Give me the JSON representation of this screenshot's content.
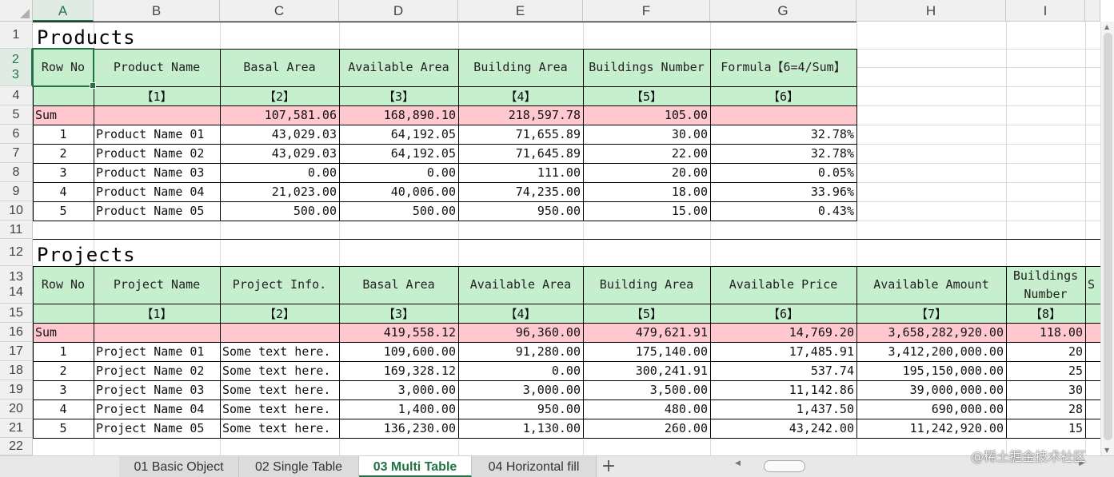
{
  "columns": [
    "A",
    "B",
    "C",
    "D",
    "E",
    "F",
    "G",
    "H",
    "I"
  ],
  "rows": [
    "1",
    "2",
    "3",
    "4",
    "5",
    "6",
    "7",
    "8",
    "9",
    "10",
    "11",
    "12",
    "13",
    "14",
    "15",
    "16",
    "17",
    "18",
    "19",
    "20",
    "21",
    "22"
  ],
  "products": {
    "title": "Products",
    "headers": [
      "Row No",
      "Product Name",
      "Basal Area",
      "Available Area",
      "Building Area",
      "Buildings Number",
      "Formula【6=4/Sum】"
    ],
    "codes": [
      "",
      "【1】",
      "【2】",
      "【3】",
      "【4】",
      "【5】",
      "【6】"
    ],
    "sum": [
      "Sum",
      "",
      "107,581.06",
      "168,890.10",
      "218,597.78",
      "105.00",
      ""
    ],
    "data": [
      [
        "1",
        "Product Name 01",
        "43,029.03",
        "64,192.05",
        "71,655.89",
        "30.00",
        "32.78%"
      ],
      [
        "2",
        "Product Name 02",
        "43,029.03",
        "64,192.05",
        "71,645.89",
        "22.00",
        "32.78%"
      ],
      [
        "3",
        "Product Name 03",
        "0.00",
        "0.00",
        "111.00",
        "20.00",
        "0.05%"
      ],
      [
        "4",
        "Product Name 04",
        "21,023.00",
        "40,006.00",
        "74,235.00",
        "18.00",
        "33.96%"
      ],
      [
        "5",
        "Product Name 05",
        "500.00",
        "500.00",
        "950.00",
        "15.00",
        "0.43%"
      ]
    ]
  },
  "projects": {
    "title": "Projects",
    "headers": [
      "Row No",
      "Project Name",
      "Project Info.",
      "Basal Area",
      "Available Area",
      "Building Area",
      "Available Price",
      "Available Amount",
      "Buildings Number",
      "S"
    ],
    "codes": [
      "",
      "【1】",
      "【2】",
      "【3】",
      "【4】",
      "【5】",
      "【6】",
      "【7】",
      "【8】",
      ""
    ],
    "sum": [
      "Sum",
      "",
      "",
      "419,558.12",
      "96,360.00",
      "479,621.91",
      "14,769.20",
      "3,658,282,920.00",
      "118.00",
      ""
    ],
    "data": [
      [
        "1",
        "Project Name 01",
        "Some text here.",
        "109,600.00",
        "91,280.00",
        "175,140.00",
        "17,485.91",
        "3,412,200,000.00",
        "20"
      ],
      [
        "2",
        "Project Name 02",
        "Some text here.",
        "169,328.12",
        "0.00",
        "300,241.91",
        "537.74",
        "195,150,000.00",
        "25"
      ],
      [
        "3",
        "Project Name 03",
        "Some text here.",
        "3,000.00",
        "3,000.00",
        "3,500.00",
        "11,142.86",
        "39,000,000.00",
        "30"
      ],
      [
        "4",
        "Project Name 04",
        "Some text here.",
        "1,400.00",
        "950.00",
        "480.00",
        "1,437.50",
        "690,000.00",
        "28"
      ],
      [
        "5",
        "Project Name 05",
        "Some text here.",
        "136,230.00",
        "1,130.00",
        "260.00",
        "43,242.00",
        "11,242,920.00",
        "15"
      ]
    ]
  },
  "sheet_tabs": [
    {
      "label": "01 Basic Object",
      "active": false
    },
    {
      "label": "02 Single Table",
      "active": false
    },
    {
      "label": "03 Multi Table",
      "active": true
    },
    {
      "label": "04 Horizontal fill",
      "active": false
    }
  ],
  "add_sheet_label": "+",
  "watermark": "@稀土掘金技术社区",
  "colors": {
    "header_green": "#c6efce",
    "sum_pink": "#ffc7ce",
    "accent": "#217346"
  }
}
